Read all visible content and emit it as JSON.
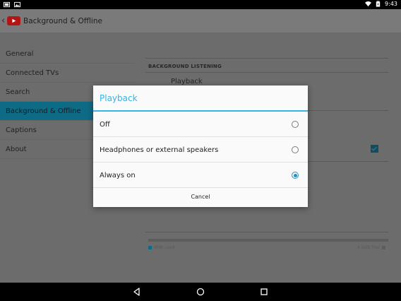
{
  "status_bar": {
    "time": "9:43",
    "left_icons": [
      "screen-icon",
      "image-icon"
    ],
    "right_icons": [
      "wifi-icon",
      "battery-icon"
    ]
  },
  "app_bar": {
    "title": "Background & Offline",
    "icons": [
      "back-chevron-icon",
      "youtube-logo-icon"
    ]
  },
  "sidebar": {
    "items": [
      {
        "label": "General",
        "active": false
      },
      {
        "label": "Connected TVs",
        "active": false
      },
      {
        "label": "Search",
        "active": false
      },
      {
        "label": "Background & Offline",
        "active": true
      },
      {
        "label": "Captions",
        "active": false
      },
      {
        "label": "About",
        "active": false
      }
    ]
  },
  "pane": {
    "section_header": "BACKGROUND LISTENING",
    "playback_title": "Playback",
    "checkbox_checked": true,
    "storage": {
      "used_label": "0MB used",
      "free_label": "4.9GB free"
    }
  },
  "dialog": {
    "title": "Playback",
    "options": [
      {
        "label": "Off",
        "selected": false
      },
      {
        "label": "Headphones or external speakers",
        "selected": false
      },
      {
        "label": "Always on",
        "selected": true
      }
    ],
    "cancel_label": "Cancel"
  },
  "nav_bar": {
    "icons": [
      "back-triangle-icon",
      "home-circle-icon",
      "recents-square-icon"
    ]
  },
  "colors": {
    "accent": "#33b5e5",
    "active_item": "#0e6b86",
    "brand_red": "#b31515"
  }
}
